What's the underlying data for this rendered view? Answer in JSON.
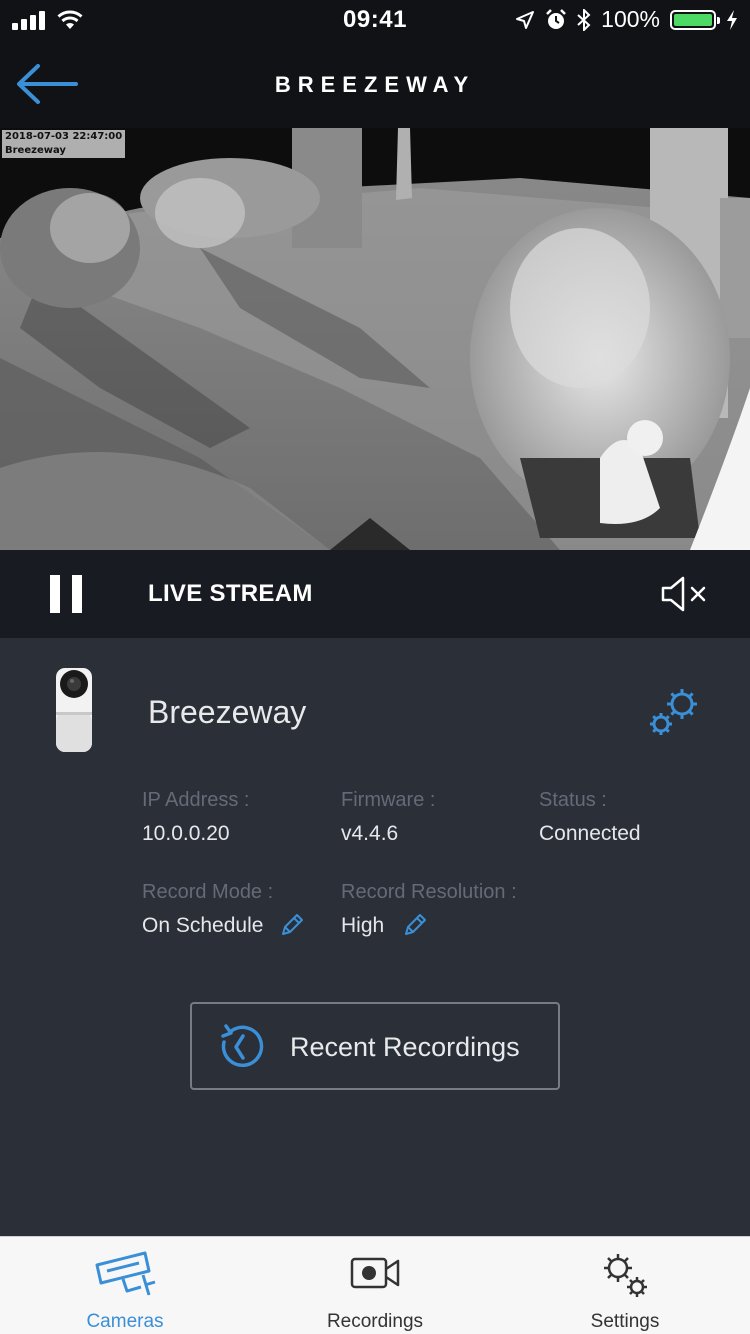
{
  "status_bar": {
    "time": "09:41",
    "battery": "100%"
  },
  "nav": {
    "title": "BREEZEWAY"
  },
  "feed": {
    "timestamp": "2018-07-03 22:47:00",
    "camera_label": "Breezeway"
  },
  "player": {
    "mode_label": "LIVE STREAM"
  },
  "camera": {
    "name": "Breezeway",
    "fields": {
      "ip_label": "IP Address :",
      "ip_value": "10.0.0.20",
      "firmware_label": "Firmware :",
      "firmware_value": "v4.4.6",
      "status_label": "Status :",
      "status_value": "Connected",
      "record_mode_label": "Record Mode :",
      "record_mode_value": "On Schedule",
      "record_res_label": "Record Resolution :",
      "record_res_value": "High"
    },
    "recent_recordings_label": "Recent Recordings"
  },
  "tabs": [
    {
      "label": "Cameras",
      "icon": "camera-icon",
      "active": true
    },
    {
      "label": "Recordings",
      "icon": "video-camera-icon",
      "active": false
    },
    {
      "label": "Settings",
      "icon": "gears-icon",
      "active": false
    }
  ],
  "colors": {
    "accent": "#3a8fd6",
    "panel": "#2a2f38",
    "bar": "#181b21",
    "battery_fill": "#4cd964",
    "inactive_tab": "#333333"
  }
}
